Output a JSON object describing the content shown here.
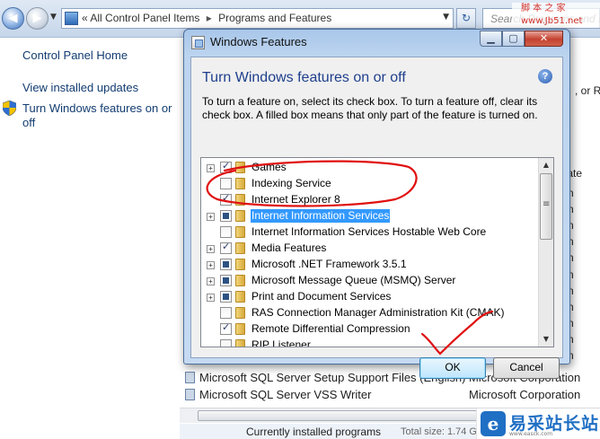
{
  "explorer": {
    "breadcrumb": [
      "All Control Panel Items",
      "Programs and Features"
    ],
    "breadcrumb_prefix": "«",
    "search_placeholder": "Search Programs and Fe",
    "nav_back": "◀",
    "nav_forward": "▶",
    "refresh_glyph": "↻"
  },
  "watermark_top": [
    "脚 本 之 家",
    "www.Jb51.net"
  ],
  "left_panel": {
    "home": "Control Panel Home",
    "updates": "View installed updates",
    "features": "Turn Windows features on or off"
  },
  "background": {
    "right_fragments": [
      ", or Re",
      "rporate",
      "n",
      "n",
      "n",
      "n",
      "n",
      "n",
      "n",
      "n",
      "n",
      "n",
      "n"
    ],
    "rows": [
      {
        "name": "Microsoft SQL Server Setup Support Files (English)",
        "publisher": "Microsoft Corporation"
      },
      {
        "name": "Microsoft SQL Server VSS Writer",
        "publisher": "Microsoft Corporation"
      }
    ],
    "status_label": "Currently installed programs",
    "status_size": "Total size: 1.74 G"
  },
  "logo": {
    "letter": "e",
    "text": "易采站长站",
    "sub": "www.easck.com"
  },
  "dialog": {
    "title": "Windows Features",
    "heading": "Turn Windows features on or off",
    "description": "To turn a feature on, select its check box. To turn a feature off, clear its check box. A filled box means that only part of the feature is turned on.",
    "help_glyph": "?",
    "buttons": {
      "minimize": "▁",
      "maximize": "▢",
      "close": "✕"
    },
    "features": [
      {
        "label": "Games",
        "expandable": true,
        "state": "checked"
      },
      {
        "label": "Indexing Service",
        "expandable": false,
        "state": "unchecked"
      },
      {
        "label": "Internet Explorer 8",
        "expandable": false,
        "state": "checked"
      },
      {
        "label": "Internet Information Services",
        "expandable": true,
        "state": "partial",
        "selected": true
      },
      {
        "label": "Internet Information Services Hostable Web Core",
        "expandable": false,
        "state": "unchecked"
      },
      {
        "label": "Media Features",
        "expandable": true,
        "state": "checked"
      },
      {
        "label": "Microsoft .NET Framework 3.5.1",
        "expandable": true,
        "state": "partial"
      },
      {
        "label": "Microsoft Message Queue (MSMQ) Server",
        "expandable": true,
        "state": "partial"
      },
      {
        "label": "Print and Document Services",
        "expandable": true,
        "state": "partial"
      },
      {
        "label": "RAS Connection Manager Administration Kit (CMAK)",
        "expandable": false,
        "state": "unchecked"
      },
      {
        "label": "Remote Differential Compression",
        "expandable": false,
        "state": "checked"
      },
      {
        "label": "RIP Listener",
        "expandable": false,
        "state": "unchecked"
      }
    ],
    "ok_label": "OK",
    "cancel_label": "Cancel"
  },
  "annotation_color": "#e01010"
}
